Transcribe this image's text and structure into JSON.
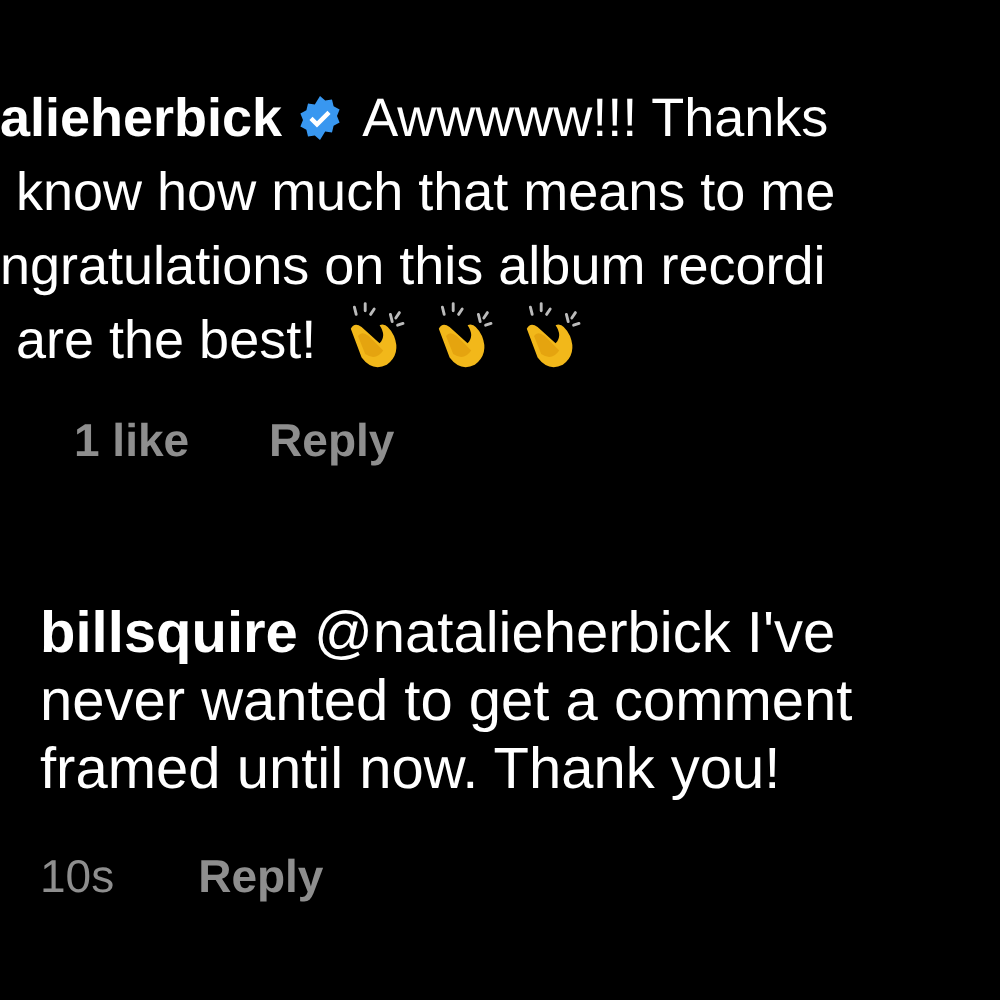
{
  "comments": [
    {
      "username": "alieherbick",
      "verified": true,
      "lines": [
        "Awwwww!!! Thanks",
        "know how much that means to me",
        "ngratulations on this album recordi",
        "are the best!"
      ],
      "emojis": [
        {
          "kind": "clap"
        },
        {
          "kind": "clap"
        },
        {
          "kind": "clap"
        }
      ],
      "likes": "1 like",
      "reply": "Reply"
    },
    {
      "text": "**billsquire** @natalieherbick I've never wanted to get a comment framed until now. Thank you!",
      "time": "10s",
      "reply": "Reply"
    }
  ]
}
